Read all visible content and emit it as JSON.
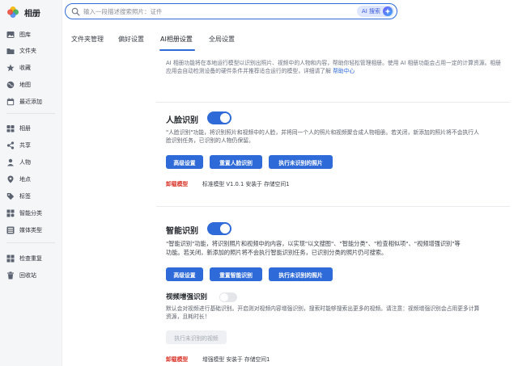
{
  "app": {
    "title": "相册"
  },
  "sidebar": {
    "items": [
      {
        "label": "图库",
        "icon": "gallery-icon"
      },
      {
        "label": "文件夹",
        "icon": "folder-icon"
      },
      {
        "label": "收藏",
        "icon": "star-icon"
      },
      {
        "label": "地图",
        "icon": "map-icon"
      },
      {
        "label": "最近添加",
        "icon": "calendar-icon"
      },
      {
        "label": "相册",
        "icon": "album-icon"
      },
      {
        "label": "共享",
        "icon": "share-icon"
      },
      {
        "label": "人物",
        "icon": "person-icon"
      },
      {
        "label": "地点",
        "icon": "location-icon"
      },
      {
        "label": "标签",
        "icon": "tag-icon"
      },
      {
        "label": "智能分类",
        "icon": "smart-category-icon"
      },
      {
        "label": "媒体类型",
        "icon": "media-type-icon"
      },
      {
        "label": "检查重复",
        "icon": "duplicate-check-icon"
      },
      {
        "label": "回收站",
        "icon": "trash-icon"
      }
    ]
  },
  "search": {
    "placeholder": "输入一段描述搜索照片：证件",
    "ai_label": "AI 搜索"
  },
  "tabs": [
    {
      "label": "文件夹管理"
    },
    {
      "label": "偏好设置"
    },
    {
      "label": "AI相册设置",
      "active": true
    },
    {
      "label": "全局设置"
    }
  ],
  "intro": {
    "text": "AI 相册功能将在本地运行模型以识别出照片、视频中的人物和内容，帮助你轻松管理相册。使用 AI 相册功能会占用一定的计算资源。相册应用会自动检测设备的硬件条件并推荐适合运行的模型，详细请了解",
    "link": "帮助中心"
  },
  "face": {
    "title": "人脸识别",
    "enabled": true,
    "desc_line1": "\"人脸识别\"功能，将识别照片和视频中的人脸，并将同一个人的照片和视频聚合成人物相册。若关闭，新添加的照片将不会执行人",
    "desc_line2": "脸识别任务，已识别的人物仍保留。",
    "buttons": {
      "advanced": "高级设置",
      "reset": "重置人脸识别",
      "run": "执行未识别的照片"
    },
    "unload": "卸载模型",
    "model": "标准模型 V1.0.1 安装于 存储空间1"
  },
  "smart": {
    "title": "智能识别",
    "enabled": true,
    "desc_line1": "\"智能识别\"功能，将识别照片和视频中的内容，以实现\"以文搜图\"、\"智能分类\"、\"检查相似项\"、\"视频增强识别\"等",
    "desc_line2": "功能。若关闭，新添加的照片将不会执行智能识别任务，已识别分类的照片仍可搜索。",
    "buttons": {
      "advanced": "高级设置",
      "reset": "重置智能识别",
      "run": "执行未识别的照片"
    }
  },
  "video": {
    "title": "视频增强识别",
    "enabled": false,
    "desc_line1": "默认会对视频进行基础识别。开启则对视频内容增强识别，搜索时能够搜索出更多的视频。请注意：视频增强识别会占用更多计算",
    "desc_line2": "资源，且耗时长！",
    "run_button": "执行未识别的视频",
    "unload": "卸载模型",
    "model": "增强模型 安装于 存储空间1"
  },
  "colors": {
    "accent": "#2f6bd8",
    "danger": "#d93025"
  }
}
